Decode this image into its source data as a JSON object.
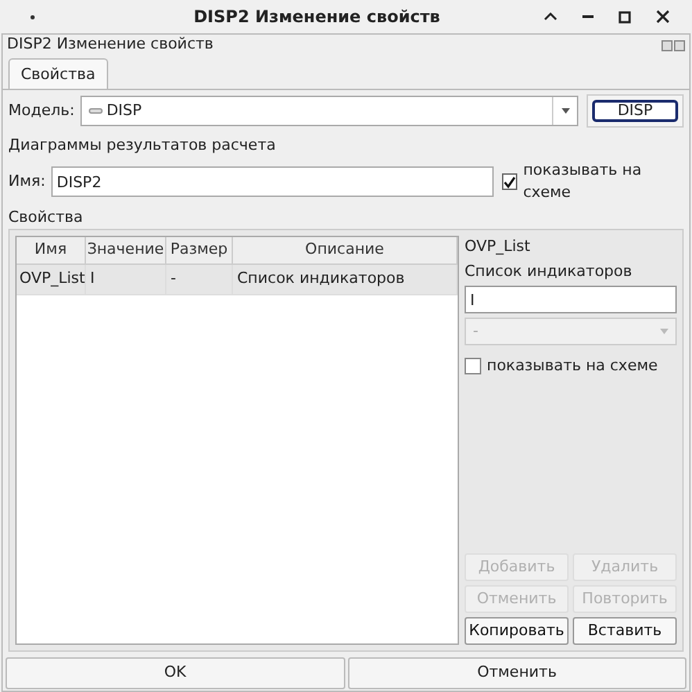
{
  "window": {
    "title": "DISP2 Изменение свойств"
  },
  "panel": {
    "title": "DISP2 Изменение свойств"
  },
  "tabs": [
    {
      "label": "Свойства",
      "selected": true
    }
  ],
  "model": {
    "label": "Модель:",
    "value": "DISP",
    "button": "DISP"
  },
  "section_label": "Диаграммы результатов расчета",
  "name_field": {
    "label": "Имя:",
    "value": "DISP2"
  },
  "show_on_scheme": {
    "label": "показывать на схеме",
    "checked": true
  },
  "properties_label": "Свойства",
  "table": {
    "columns": [
      "Имя",
      "Значение",
      "Размер",
      "Описание"
    ],
    "rows": [
      {
        "cells": [
          "OVP_List",
          "I",
          "-",
          "Список индикаторов"
        ],
        "selected": true
      }
    ]
  },
  "details": {
    "name": "OVP_List",
    "description": "Список индикаторов",
    "value": "I",
    "dropdown": {
      "value": "-",
      "disabled": true
    },
    "show_on_scheme": {
      "label": "показывать на схеме",
      "checked": false
    }
  },
  "actions": [
    {
      "label": "Добавить",
      "disabled": true
    },
    {
      "label": "Удалить",
      "disabled": true
    },
    {
      "label": "Отменить",
      "disabled": true
    },
    {
      "label": "Повторить",
      "disabled": true
    },
    {
      "label": "Копировать",
      "disabled": false
    },
    {
      "label": "Вставить",
      "disabled": false
    }
  ],
  "dialog_buttons": [
    "OK",
    "Отменить"
  ]
}
